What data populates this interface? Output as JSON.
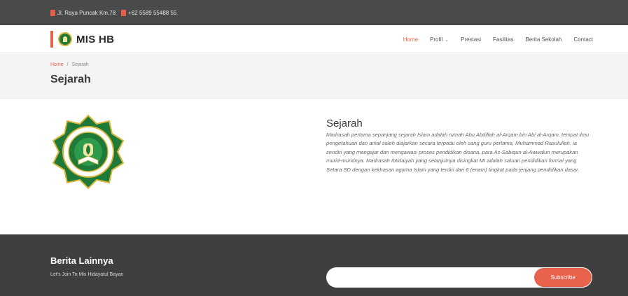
{
  "topbar": {
    "address": "Jl. Raya Puncak Km.78",
    "phone": "+62 5589 55488 55"
  },
  "brand": {
    "name": "MIS HB"
  },
  "nav": {
    "items": [
      {
        "label": "Home",
        "active": true
      },
      {
        "label": "Profil",
        "has_dropdown": true
      },
      {
        "label": "Prestasi"
      },
      {
        "label": "Fasilitas"
      },
      {
        "label": "Berita Sekolah"
      },
      {
        "label": "Contact"
      }
    ]
  },
  "breadcrumb": {
    "home": "Home",
    "separator": "/",
    "current": "Sejarah"
  },
  "page": {
    "title": "Sejarah"
  },
  "content": {
    "heading": "Sejarah",
    "body": "Madrasah pertama sepanjang sejarah Islam adalah rumah Abu Abdillah al-Arqam bin Abi al-Arqam, tempat ilmu pengetahuan dan amal saleh diajarkan secara terpadu oleh sang guru pertama, Muhammad Rasulullah. ia sendiri yang mengajar dan mengawasi proses pendidikan disana, para As-Sabiqun al-Awwalun merupakan murid-muridnya. Madrasah Ibtidaiyah yang selanjutnya disingkat MI adalah satuan pendidikan formal yang Setara SD dengan kekhasan agama Islam yang terdiri dari 6 (enam) tingkat pada jenjang pendidikan dasar."
  },
  "footer": {
    "title": "Berita Lainnya",
    "subtitle": "Let's Join To Mis Hidayatul Bayan",
    "email_value": "",
    "subscribe_label": "Subscribe"
  },
  "colors": {
    "accent": "#e9624c",
    "topbar": "#4a4a4a",
    "footer": "#3f3f3f",
    "emblem_green": "#1f7a3a",
    "emblem_gold": "#d8b63a"
  },
  "icons": {
    "address": "map-marker-icon",
    "phone": "phone-icon",
    "logo": "school-emblem-icon"
  }
}
